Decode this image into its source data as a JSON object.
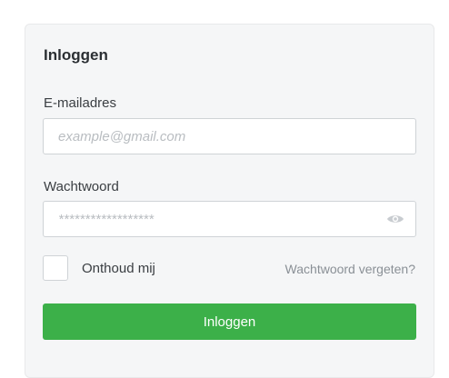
{
  "form": {
    "title": "Inloggen",
    "email": {
      "label": "E-mailadres",
      "placeholder": "example@gmail.com",
      "value": ""
    },
    "password": {
      "label": "Wachtwoord",
      "placeholder": "******************",
      "value": "",
      "toggle_icon": "eye-icon"
    },
    "remember": {
      "label": "Onthoud mij",
      "checked": false
    },
    "forgot_link": "Wachtwoord vergeten?",
    "submit_label": "Inloggen"
  },
  "colors": {
    "accent": "#3cb049",
    "card_background": "#f5f6f7",
    "muted_link": "#8a9096"
  }
}
